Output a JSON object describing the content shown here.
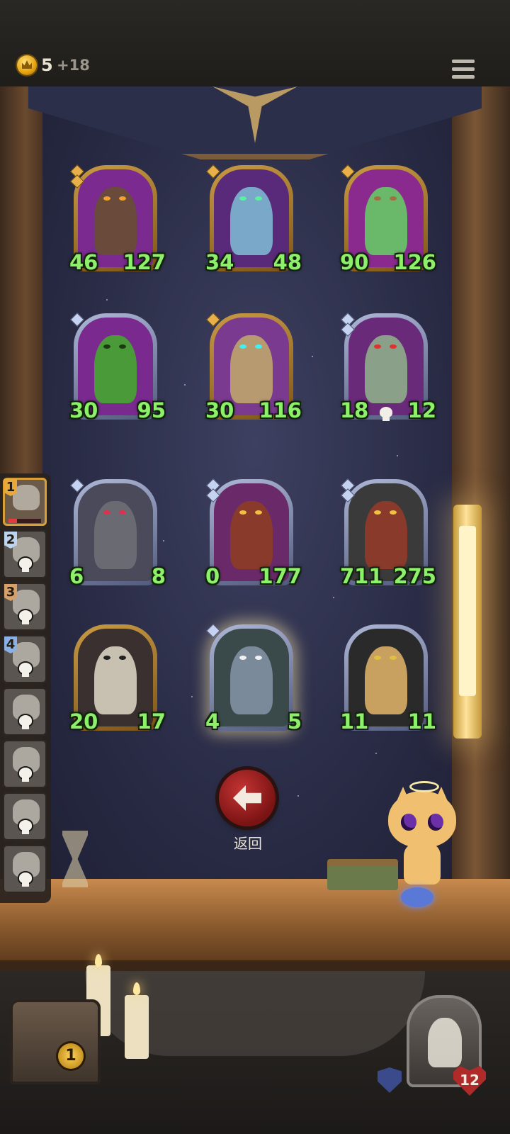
{
  "header": {
    "gold": "5",
    "gold_increment": "+18"
  },
  "board": {
    "cards": [
      {
        "atk": "46",
        "hp": "127",
        "frame": "gold",
        "bg": "#7b2a8f",
        "fig": "#6a4a3a",
        "eye": "#f5a030",
        "tier_gems": 2,
        "skull": false,
        "glow": false
      },
      {
        "atk": "34",
        "hp": "48",
        "frame": "gold",
        "bg": "#5a2a7a",
        "fig": "#7aa8c8",
        "eye": "#5af0a0",
        "tier_gems": 1,
        "skull": false,
        "glow": false
      },
      {
        "atk": "90",
        "hp": "126",
        "frame": "gold",
        "bg": "#8a2a8f",
        "fig": "#6ab86a",
        "eye": "#a07040",
        "tier_gems": 1,
        "skull": false,
        "glow": false
      },
      {
        "atk": "30",
        "hp": "95",
        "frame": "silver",
        "bg": "#7a2a8f",
        "fig": "#4a9a3a",
        "eye": "#1a3a10",
        "tier_gems": 1,
        "skull": false,
        "glow": false
      },
      {
        "atk": "30",
        "hp": "116",
        "frame": "gold",
        "bg": "#7a3a8f",
        "fig": "#b89a70",
        "eye": "#40f0f0",
        "tier_gems": 1,
        "skull": false,
        "glow": false
      },
      {
        "atk": "18",
        "hp": "12",
        "frame": "silver",
        "bg": "#6a2a7a",
        "fig": "#8aa088",
        "eye": "#e03030",
        "tier_gems": 2,
        "skull": true,
        "glow": false
      },
      {
        "atk": "6",
        "hp": "8",
        "frame": "silver",
        "bg": "#4a4a5a",
        "fig": "#6a6a72",
        "eye": "#e03050",
        "tier_gems": 1,
        "skull": false,
        "glow": false
      },
      {
        "atk": "0",
        "hp": "177",
        "frame": "silver",
        "bg": "#6a2a6a",
        "fig": "#8a3a2a",
        "eye": "#f0c040",
        "tier_gems": 2,
        "skull": false,
        "glow": false
      },
      {
        "atk": "711",
        "hp": "275",
        "frame": "silver",
        "bg": "#3a3a3a",
        "fig": "#8a3a2a",
        "eye": "#f0c040",
        "tier_gems": 2,
        "skull": false,
        "glow": false
      },
      {
        "atk": "20",
        "hp": "17",
        "frame": "gold",
        "bg": "#3a3030",
        "fig": "#c8c0b0",
        "eye": "#202020",
        "tier_gems": 0,
        "skull": false,
        "glow": false
      },
      {
        "atk": "4",
        "hp": "5",
        "frame": "silver",
        "bg": "#3a4a4a",
        "fig": "#7a8a9a",
        "eye": "#f0f0f0",
        "tier_gems": 1,
        "skull": false,
        "glow": true
      },
      {
        "atk": "11",
        "hp": "11",
        "frame": "silver",
        "bg": "#2a2a2a",
        "fig": "#c8a060",
        "eye": "#e0c040",
        "tier_gems": 0,
        "skull": false,
        "glow": false
      }
    ]
  },
  "back_button": {
    "label": "返回"
  },
  "sidebar": {
    "opponents": [
      {
        "rank": "1",
        "active": true,
        "dead": false,
        "hp_fraction": 0.25
      },
      {
        "rank": "2",
        "active": false,
        "dead": true
      },
      {
        "rank": "3",
        "active": false,
        "dead": true
      },
      {
        "rank": "4",
        "active": false,
        "dead": true
      },
      {
        "rank": "",
        "active": false,
        "dead": true
      },
      {
        "rank": "",
        "active": false,
        "dead": true
      },
      {
        "rank": "",
        "active": false,
        "dead": true
      },
      {
        "rank": "",
        "active": false,
        "dead": true
      }
    ]
  },
  "footer": {
    "chest_count": "1",
    "hero_health": "12"
  },
  "colors": {
    "atk_text": "#8ef06a",
    "gold_frame": "#c89a44",
    "silver_frame": "#aeb7d6",
    "back_button": "#a51d1d"
  }
}
